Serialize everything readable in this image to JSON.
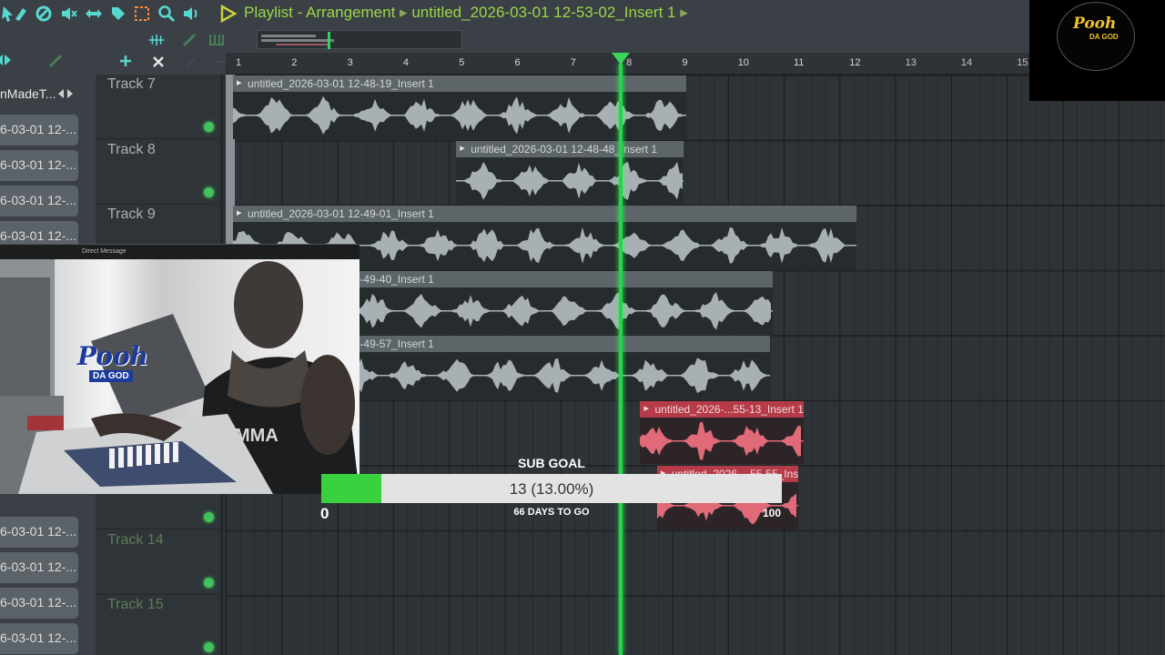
{
  "toolbar": {
    "title": "Playlist - Arrangement",
    "breadcrumb_sep": "▸",
    "pattern_name": "untitled_2026-03-01 12-53-02_Insert 1",
    "tail_arrow": "▸",
    "icons": [
      "arrow-icon",
      "brush-icon",
      "no-icon",
      "mute-icon",
      "slip-icon",
      "select-icon",
      "box-select-icon",
      "zoom-icon",
      "speaker-icon"
    ]
  },
  "ruler": {
    "bars": [
      "1",
      "2",
      "3",
      "4",
      "5",
      "6",
      "7",
      "8",
      "9",
      "10",
      "11",
      "12",
      "13",
      "14",
      "15"
    ]
  },
  "picker": {
    "items": [
      "nMadeT...",
      "6-03-01 12-...",
      "6-03-01 12-...",
      "6-03-01 12-...",
      "6-03-01 12-...",
      "6-03-01 12-...",
      "6-03-01 12-...",
      "6-03-01 12-...",
      "6-03-01 12-..."
    ]
  },
  "tracks": [
    {
      "name": "Track 7",
      "dim": false
    },
    {
      "name": "Track 8",
      "dim": false
    },
    {
      "name": "Track 9",
      "dim": false
    },
    {
      "name": "",
      "dim": false
    },
    {
      "name": "",
      "dim": false
    },
    {
      "name": "",
      "dim": false
    },
    {
      "name": "",
      "dim": false
    },
    {
      "name": "Track 14",
      "dim": true
    },
    {
      "name": "Track 15",
      "dim": true
    }
  ],
  "clips": [
    {
      "label": "untitled_2026-03-01 12-48-19_Insert 1",
      "track": 0,
      "start_bar": 1.0,
      "end_bar": 9.0,
      "color": "gray"
    },
    {
      "label": "untitled_2026-03-01 12-48-48_Insert 1",
      "track": 1,
      "start_bar": 5.0,
      "end_bar": 8.95,
      "color": "gray"
    },
    {
      "label": "untitled_2026-03-01 12-49-01_Insert 1",
      "track": 2,
      "start_bar": 1.0,
      "end_bar": 12.05,
      "color": "gray"
    },
    {
      "label": "untitled_2026-03-01 12-49-40_Insert 1",
      "track": 3,
      "start_bar": 1.0,
      "end_bar": 10.55,
      "color": "gray"
    },
    {
      "label": "untitled_2026-03-01 12-49-57_Insert 1",
      "track": 4,
      "start_bar": 1.0,
      "end_bar": 10.5,
      "color": "gray"
    },
    {
      "label": "untitled_2026-...55-13_Insert 1",
      "track": 5,
      "start_bar": 8.3,
      "end_bar": 11.1,
      "color": "red"
    },
    {
      "label": "untitled_2026-...55-55_Insert 1",
      "track": 6,
      "start_bar": 8.6,
      "end_bar": 11.0,
      "color": "red"
    }
  ],
  "playhead_bar": 7.88,
  "overlay": {
    "logo_main": "Pooh",
    "logo_sub": "DA GOD",
    "webcam_title": "Direct Message",
    "cam_logo": "Pooh",
    "cam_logo_sub": "DA GOD"
  },
  "sub_goal": {
    "title": "SUB GOAL",
    "value_text": "13 (13.00%)",
    "progress": 0.13,
    "min": "0",
    "max": "100",
    "days_text": "66 DAYS TO GO"
  },
  "colors": {
    "accent": "#9cd64a",
    "playhead": "#1fd84a",
    "clip_red": "#b63b48",
    "goal_fill": "#3ad13f"
  }
}
